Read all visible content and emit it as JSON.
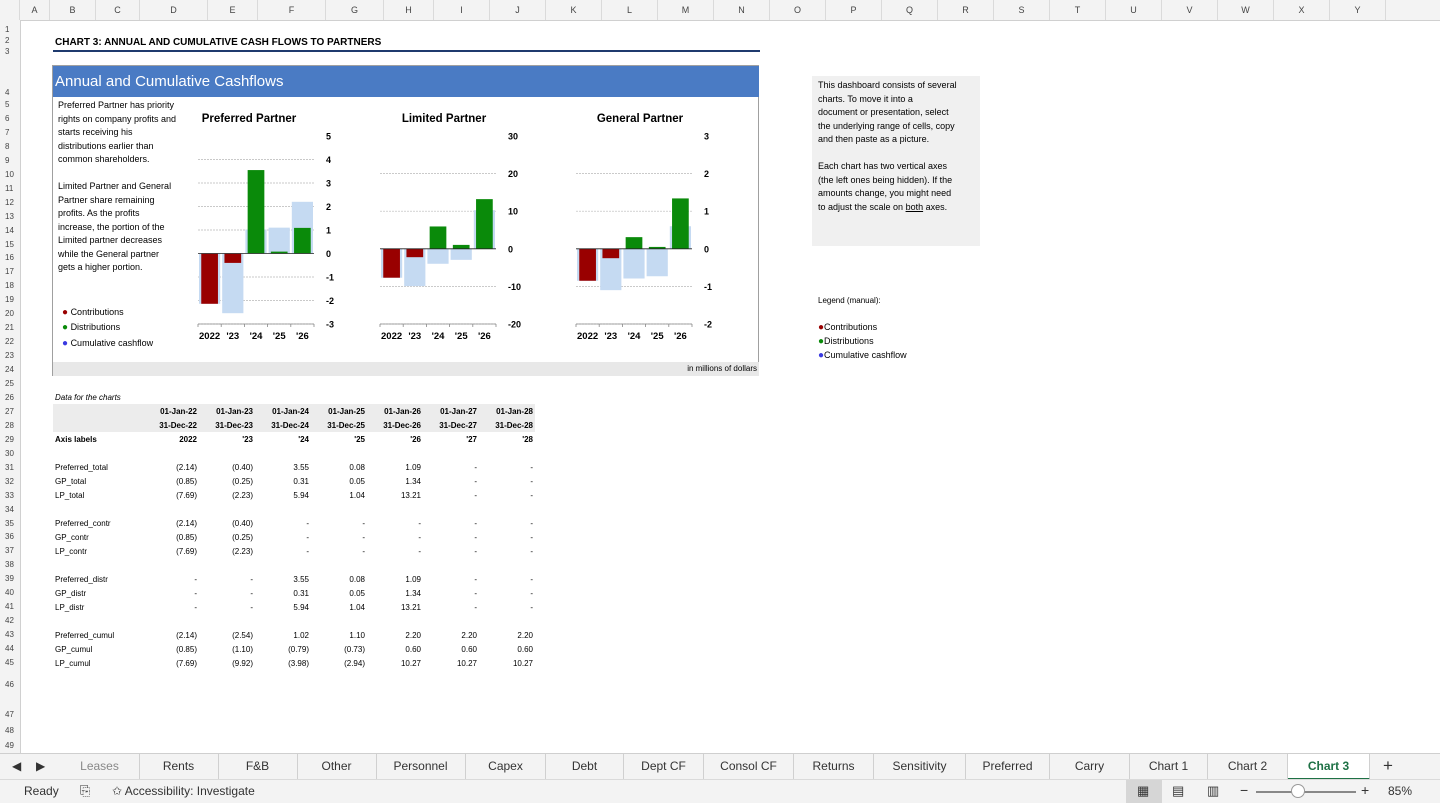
{
  "columns": [
    "A",
    "B",
    "C",
    "D",
    "E",
    "F",
    "G",
    "H",
    "I",
    "J",
    "K",
    "L",
    "M",
    "N",
    "O",
    "P",
    "Q",
    "R",
    "S",
    "T",
    "U",
    "V",
    "W",
    "X",
    "Y"
  ],
  "rows": [
    "1",
    "2",
    "3",
    "4",
    "5",
    "6",
    "7",
    "8",
    "9",
    "10",
    "11",
    "12",
    "13",
    "14",
    "15",
    "16",
    "17",
    "18",
    "19",
    "20",
    "21",
    "22",
    "23",
    "24",
    "25",
    "26",
    "27",
    "28",
    "29",
    "30",
    "31",
    "32",
    "33",
    "34",
    "35",
    "36",
    "37",
    "38",
    "39",
    "40",
    "41",
    "42",
    "43",
    "44",
    "45",
    "46",
    "47",
    "48",
    "49"
  ],
  "heading": "CHART 3: ANNUAL AND CUMULATIVE CASH FLOWS TO PARTNERS",
  "dashboard": {
    "title": "Annual and Cumulative Cashflows",
    "para1": [
      "Preferred Partner has priority",
      "rights on company profits and",
      "starts receiving his",
      "distributions earlier than",
      "common shareholders."
    ],
    "para2": [
      "Limited Partner and General",
      "Partner share remaining",
      "profits. As the profits",
      "increase, the portion of the",
      "Limited partner decreases",
      "while the General partner",
      "gets a higher portion."
    ],
    "legend": {
      "contr": "Contributions",
      "distr": "Distributions",
      "cumul": "Cumulative cashflow"
    },
    "footnote": "in millions of dollars"
  },
  "colors": {
    "contributions": "#990000",
    "distributions": "#0a8a0a",
    "cumulative": "#c5daf2",
    "title_bar": "#4a7bc4",
    "legend_cumul_dot": "#3a3ae0"
  },
  "chart_data": [
    {
      "type": "bar",
      "title": "Preferred Partner",
      "categories": [
        "2022",
        "'23",
        "'24",
        "'25",
        "'26"
      ],
      "series": [
        {
          "name": "Contributions",
          "values": [
            -2.14,
            -0.4,
            0,
            0,
            0
          ]
        },
        {
          "name": "Distributions",
          "values": [
            0,
            0,
            3.55,
            0.08,
            1.09
          ]
        },
        {
          "name": "Cumulative cashflow",
          "values": [
            -2.14,
            -2.54,
            1.02,
            1.1,
            2.2
          ]
        }
      ],
      "ylim": [
        -3,
        5
      ],
      "ticks": [
        "5",
        "4",
        "3",
        "2",
        "1",
        "0",
        "-1",
        "-2",
        "-3"
      ]
    },
    {
      "type": "bar",
      "title": "Limited Partner",
      "categories": [
        "2022",
        "'23",
        "'24",
        "'25",
        "'26"
      ],
      "series": [
        {
          "name": "Contributions",
          "values": [
            -7.69,
            -2.23,
            0,
            0,
            0
          ]
        },
        {
          "name": "Distributions",
          "values": [
            0,
            0,
            5.94,
            1.04,
            13.21
          ]
        },
        {
          "name": "Cumulative cashflow",
          "values": [
            -7.69,
            -9.92,
            -3.98,
            -2.94,
            10.27
          ]
        }
      ],
      "ylim": [
        -20,
        30
      ],
      "ticks": [
        "30",
        "20",
        "10",
        "0",
        "-10",
        "-20"
      ]
    },
    {
      "type": "bar",
      "title": "General Partner",
      "categories": [
        "2022",
        "'23",
        "'24",
        "'25",
        "'26"
      ],
      "series": [
        {
          "name": "Contributions",
          "values": [
            -0.85,
            -0.25,
            0,
            0,
            0
          ]
        },
        {
          "name": "Distributions",
          "values": [
            0,
            0,
            0.31,
            0.05,
            1.34
          ]
        },
        {
          "name": "Cumulative cashflow",
          "values": [
            -0.85,
            -1.1,
            -0.79,
            -0.73,
            0.6
          ]
        }
      ],
      "ylim": [
        -2,
        3
      ],
      "ticks": [
        "3",
        "2",
        "1",
        "0",
        "-1",
        "-2"
      ]
    }
  ],
  "note": {
    "p1": [
      "This dashboard consists of several",
      "charts. To move it into a",
      "document or presentation, select",
      "the underlying range of cells, copy",
      "and then paste as a picture."
    ],
    "p2a": [
      "Each chart has two vertical axes",
      "(the left ones being hidden). If the",
      "amounts change, you might need"
    ],
    "p2b_pre": "to adjust the scale on ",
    "p2b_u": "both",
    "p2b_post": " axes."
  },
  "legend_manual": {
    "title": "Legend (manual):",
    "contr": "Contributions",
    "distr": "Distributions",
    "cumul": "Cumulative cashflow"
  },
  "table": {
    "caption": "Data for the charts",
    "start_dates": [
      "01-Jan-22",
      "01-Jan-23",
      "01-Jan-24",
      "01-Jan-25",
      "01-Jan-26",
      "01-Jan-27",
      "01-Jan-28"
    ],
    "end_dates": [
      "31-Dec-22",
      "31-Dec-23",
      "31-Dec-24",
      "31-Dec-25",
      "31-Dec-26",
      "31-Dec-27",
      "31-Dec-28"
    ],
    "axis_label_title": "Axis labels",
    "axis_labels": [
      "2022",
      "'23",
      "'24",
      "'25",
      "'26",
      "'27",
      "'28"
    ],
    "groups": [
      [
        {
          "label": "Preferred_total",
          "vals": [
            "(2.14)",
            "(0.40)",
            "3.55",
            "0.08",
            "1.09",
            "-",
            "-"
          ]
        },
        {
          "label": "GP_total",
          "vals": [
            "(0.85)",
            "(0.25)",
            "0.31",
            "0.05",
            "1.34",
            "-",
            "-"
          ]
        },
        {
          "label": "LP_total",
          "vals": [
            "(7.69)",
            "(2.23)",
            "5.94",
            "1.04",
            "13.21",
            "-",
            "-"
          ]
        }
      ],
      [
        {
          "label": "Preferred_contr",
          "vals": [
            "(2.14)",
            "(0.40)",
            "-",
            "-",
            "-",
            "-",
            "-"
          ]
        },
        {
          "label": "GP_contr",
          "vals": [
            "(0.85)",
            "(0.25)",
            "-",
            "-",
            "-",
            "-",
            "-"
          ]
        },
        {
          "label": "LP_contr",
          "vals": [
            "(7.69)",
            "(2.23)",
            "-",
            "-",
            "-",
            "-",
            "-"
          ]
        }
      ],
      [
        {
          "label": "Preferred_distr",
          "vals": [
            "-",
            "-",
            "3.55",
            "0.08",
            "1.09",
            "-",
            "-"
          ]
        },
        {
          "label": "GP_distr",
          "vals": [
            "-",
            "-",
            "0.31",
            "0.05",
            "1.34",
            "-",
            "-"
          ]
        },
        {
          "label": "LP_distr",
          "vals": [
            "-",
            "-",
            "5.94",
            "1.04",
            "13.21",
            "-",
            "-"
          ]
        }
      ],
      [
        {
          "label": "Preferred_cumul",
          "vals": [
            "(2.14)",
            "(2.54)",
            "1.02",
            "1.10",
            "2.20",
            "2.20",
            "2.20"
          ]
        },
        {
          "label": "GP_cumul",
          "vals": [
            "(0.85)",
            "(1.10)",
            "(0.79)",
            "(0.73)",
            "0.60",
            "0.60",
            "0.60"
          ]
        },
        {
          "label": "LP_cumul",
          "vals": [
            "(7.69)",
            "(9.92)",
            "(3.98)",
            "(2.94)",
            "10.27",
            "10.27",
            "10.27"
          ]
        }
      ]
    ]
  },
  "tabs": [
    "Leases",
    "Rents",
    "F&B",
    "Other",
    "Personnel",
    "Capex",
    "Debt",
    "Dept CF",
    "Consol CF",
    "Returns",
    "Sensitivity",
    "Preferred",
    "Carry",
    "Chart 1",
    "Chart 2",
    "Chart 3"
  ],
  "active_tab": "Chart 3",
  "status": {
    "ready": "Ready",
    "accessibility": "Accessibility: Investigate",
    "zoom": "85%"
  }
}
